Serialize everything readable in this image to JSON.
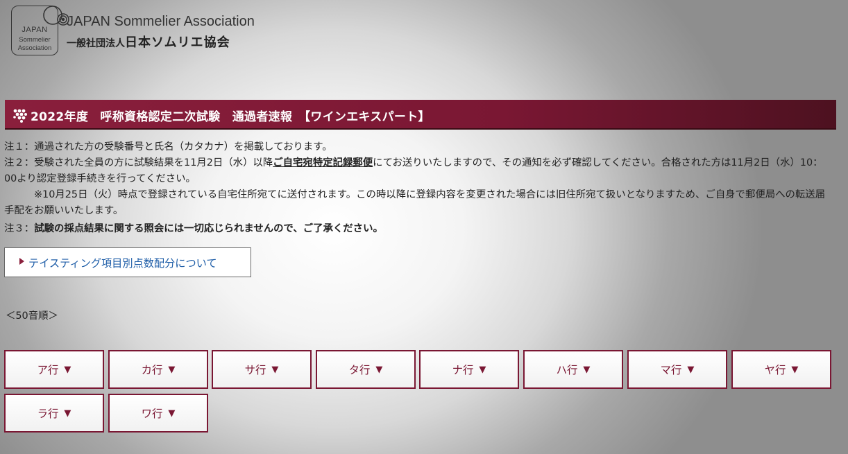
{
  "header": {
    "logo_badge_line1": "JAPAN",
    "logo_badge_line2": "Sommelier",
    "logo_badge_line3": "Association",
    "org_name_en": "JAPAN Sommelier Association",
    "org_prefix_jp": "一般社団法人",
    "org_name_jp": "日本ソムリエ協会"
  },
  "title_bar": {
    "title": "2022年度　呼称資格認定二次試験　通過者速報　【ワインエキスパート】",
    "bg_color": "#7a1733"
  },
  "notes": {
    "note1": "注１：通過された方の受験番号と氏名（カタカナ）を掲載しております。",
    "note2_pre": "注２：受験された全員の方に試験結果を11月2日（水）以降",
    "note2_emph": "ご自宅宛特定記録郵便",
    "note2_post": "にてお送りいたしますので、その通知を必ず確認してください。合格された方は11月2日（水）10：00より認定登録手続きを行ってください。",
    "note2_sub": "※10月25日（火）時点で登録されている自宅住所宛てに送付されます。この時以降に登録内容を変更された場合には旧住所宛て扱いとなりますため、ご自身で郵便局への転送届手配をお願いいたします。",
    "note3_pre": "注３：",
    "note3_bold": "試験の採点結果に関する照会には一切応じられませんので、ご了承ください。"
  },
  "tasting_link": {
    "label": "テイスティング項目別点数配分について",
    "link_color": "#1f5ea8"
  },
  "order_label": "＜50音順＞",
  "kana_buttons": {
    "a": "ア行",
    "ka": "カ行",
    "sa": "サ行",
    "ta": "タ行",
    "na": "ナ行",
    "ha": "ハ行",
    "ma": "マ行",
    "ya": "ヤ行",
    "ra": "ラ行",
    "wa": "ワ行",
    "arrow": "▼",
    "accent_color": "#7a1733"
  }
}
